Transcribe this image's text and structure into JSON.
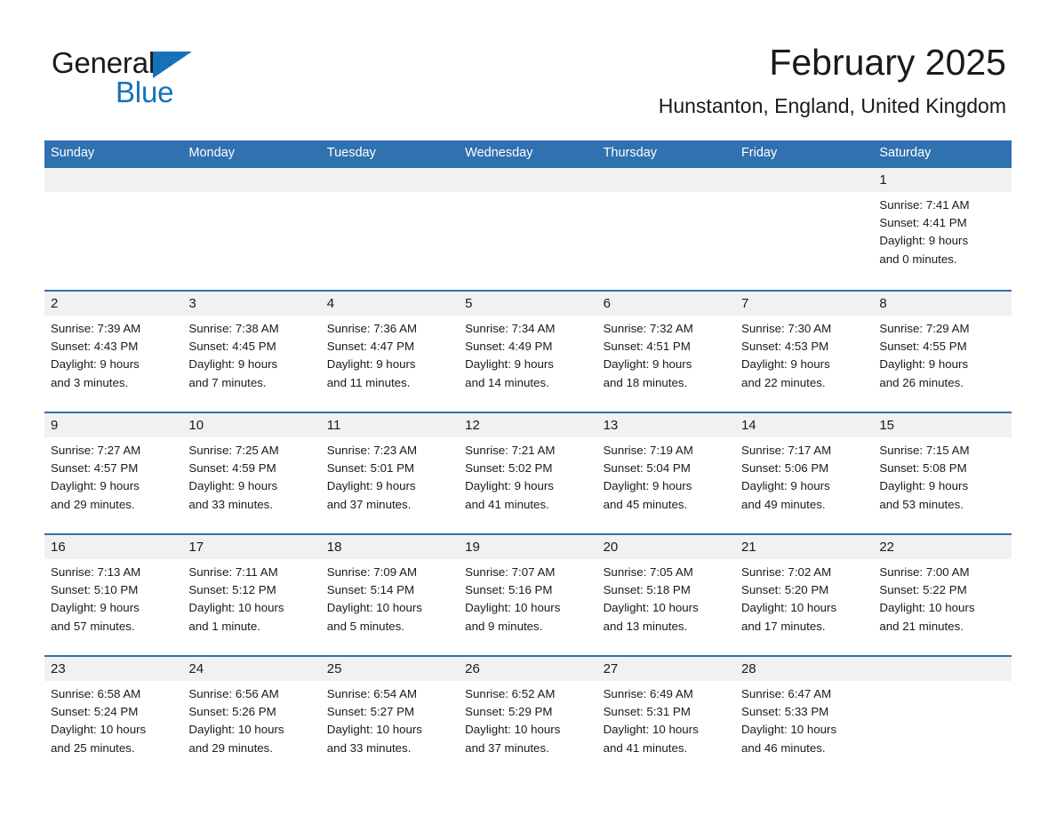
{
  "brand": {
    "name_part1": "General",
    "name_part2": "Blue",
    "triangle_color": "#1572b8",
    "text_color": "#1a1a1a"
  },
  "header": {
    "title": "February 2025",
    "subtitle": "Hunstanton, England, United Kingdom"
  },
  "theme": {
    "header_blue": "#3071b0",
    "daynum_band": "#f1f1f1",
    "text": "#1a1a1a"
  },
  "weekdays": [
    "Sunday",
    "Monday",
    "Tuesday",
    "Wednesday",
    "Thursday",
    "Friday",
    "Saturday"
  ],
  "weeks": [
    {
      "days": [
        {
          "num": "",
          "sunrise": "",
          "sunset": "",
          "daylight_line1": "",
          "daylight_line2": ""
        },
        {
          "num": "",
          "sunrise": "",
          "sunset": "",
          "daylight_line1": "",
          "daylight_line2": ""
        },
        {
          "num": "",
          "sunrise": "",
          "sunset": "",
          "daylight_line1": "",
          "daylight_line2": ""
        },
        {
          "num": "",
          "sunrise": "",
          "sunset": "",
          "daylight_line1": "",
          "daylight_line2": ""
        },
        {
          "num": "",
          "sunrise": "",
          "sunset": "",
          "daylight_line1": "",
          "daylight_line2": ""
        },
        {
          "num": "",
          "sunrise": "",
          "sunset": "",
          "daylight_line1": "",
          "daylight_line2": ""
        },
        {
          "num": "1",
          "sunrise": "Sunrise: 7:41 AM",
          "sunset": "Sunset: 4:41 PM",
          "daylight_line1": "Daylight: 9 hours",
          "daylight_line2": "and 0 minutes."
        }
      ]
    },
    {
      "days": [
        {
          "num": "2",
          "sunrise": "Sunrise: 7:39 AM",
          "sunset": "Sunset: 4:43 PM",
          "daylight_line1": "Daylight: 9 hours",
          "daylight_line2": "and 3 minutes."
        },
        {
          "num": "3",
          "sunrise": "Sunrise: 7:38 AM",
          "sunset": "Sunset: 4:45 PM",
          "daylight_line1": "Daylight: 9 hours",
          "daylight_line2": "and 7 minutes."
        },
        {
          "num": "4",
          "sunrise": "Sunrise: 7:36 AM",
          "sunset": "Sunset: 4:47 PM",
          "daylight_line1": "Daylight: 9 hours",
          "daylight_line2": "and 11 minutes."
        },
        {
          "num": "5",
          "sunrise": "Sunrise: 7:34 AM",
          "sunset": "Sunset: 4:49 PM",
          "daylight_line1": "Daylight: 9 hours",
          "daylight_line2": "and 14 minutes."
        },
        {
          "num": "6",
          "sunrise": "Sunrise: 7:32 AM",
          "sunset": "Sunset: 4:51 PM",
          "daylight_line1": "Daylight: 9 hours",
          "daylight_line2": "and 18 minutes."
        },
        {
          "num": "7",
          "sunrise": "Sunrise: 7:30 AM",
          "sunset": "Sunset: 4:53 PM",
          "daylight_line1": "Daylight: 9 hours",
          "daylight_line2": "and 22 minutes."
        },
        {
          "num": "8",
          "sunrise": "Sunrise: 7:29 AM",
          "sunset": "Sunset: 4:55 PM",
          "daylight_line1": "Daylight: 9 hours",
          "daylight_line2": "and 26 minutes."
        }
      ]
    },
    {
      "days": [
        {
          "num": "9",
          "sunrise": "Sunrise: 7:27 AM",
          "sunset": "Sunset: 4:57 PM",
          "daylight_line1": "Daylight: 9 hours",
          "daylight_line2": "and 29 minutes."
        },
        {
          "num": "10",
          "sunrise": "Sunrise: 7:25 AM",
          "sunset": "Sunset: 4:59 PM",
          "daylight_line1": "Daylight: 9 hours",
          "daylight_line2": "and 33 minutes."
        },
        {
          "num": "11",
          "sunrise": "Sunrise: 7:23 AM",
          "sunset": "Sunset: 5:01 PM",
          "daylight_line1": "Daylight: 9 hours",
          "daylight_line2": "and 37 minutes."
        },
        {
          "num": "12",
          "sunrise": "Sunrise: 7:21 AM",
          "sunset": "Sunset: 5:02 PM",
          "daylight_line1": "Daylight: 9 hours",
          "daylight_line2": "and 41 minutes."
        },
        {
          "num": "13",
          "sunrise": "Sunrise: 7:19 AM",
          "sunset": "Sunset: 5:04 PM",
          "daylight_line1": "Daylight: 9 hours",
          "daylight_line2": "and 45 minutes."
        },
        {
          "num": "14",
          "sunrise": "Sunrise: 7:17 AM",
          "sunset": "Sunset: 5:06 PM",
          "daylight_line1": "Daylight: 9 hours",
          "daylight_line2": "and 49 minutes."
        },
        {
          "num": "15",
          "sunrise": "Sunrise: 7:15 AM",
          "sunset": "Sunset: 5:08 PM",
          "daylight_line1": "Daylight: 9 hours",
          "daylight_line2": "and 53 minutes."
        }
      ]
    },
    {
      "days": [
        {
          "num": "16",
          "sunrise": "Sunrise: 7:13 AM",
          "sunset": "Sunset: 5:10 PM",
          "daylight_line1": "Daylight: 9 hours",
          "daylight_line2": "and 57 minutes."
        },
        {
          "num": "17",
          "sunrise": "Sunrise: 7:11 AM",
          "sunset": "Sunset: 5:12 PM",
          "daylight_line1": "Daylight: 10 hours",
          "daylight_line2": "and 1 minute."
        },
        {
          "num": "18",
          "sunrise": "Sunrise: 7:09 AM",
          "sunset": "Sunset: 5:14 PM",
          "daylight_line1": "Daylight: 10 hours",
          "daylight_line2": "and 5 minutes."
        },
        {
          "num": "19",
          "sunrise": "Sunrise: 7:07 AM",
          "sunset": "Sunset: 5:16 PM",
          "daylight_line1": "Daylight: 10 hours",
          "daylight_line2": "and 9 minutes."
        },
        {
          "num": "20",
          "sunrise": "Sunrise: 7:05 AM",
          "sunset": "Sunset: 5:18 PM",
          "daylight_line1": "Daylight: 10 hours",
          "daylight_line2": "and 13 minutes."
        },
        {
          "num": "21",
          "sunrise": "Sunrise: 7:02 AM",
          "sunset": "Sunset: 5:20 PM",
          "daylight_line1": "Daylight: 10 hours",
          "daylight_line2": "and 17 minutes."
        },
        {
          "num": "22",
          "sunrise": "Sunrise: 7:00 AM",
          "sunset": "Sunset: 5:22 PM",
          "daylight_line1": "Daylight: 10 hours",
          "daylight_line2": "and 21 minutes."
        }
      ]
    },
    {
      "days": [
        {
          "num": "23",
          "sunrise": "Sunrise: 6:58 AM",
          "sunset": "Sunset: 5:24 PM",
          "daylight_line1": "Daylight: 10 hours",
          "daylight_line2": "and 25 minutes."
        },
        {
          "num": "24",
          "sunrise": "Sunrise: 6:56 AM",
          "sunset": "Sunset: 5:26 PM",
          "daylight_line1": "Daylight: 10 hours",
          "daylight_line2": "and 29 minutes."
        },
        {
          "num": "25",
          "sunrise": "Sunrise: 6:54 AM",
          "sunset": "Sunset: 5:27 PM",
          "daylight_line1": "Daylight: 10 hours",
          "daylight_line2": "and 33 minutes."
        },
        {
          "num": "26",
          "sunrise": "Sunrise: 6:52 AM",
          "sunset": "Sunset: 5:29 PM",
          "daylight_line1": "Daylight: 10 hours",
          "daylight_line2": "and 37 minutes."
        },
        {
          "num": "27",
          "sunrise": "Sunrise: 6:49 AM",
          "sunset": "Sunset: 5:31 PM",
          "daylight_line1": "Daylight: 10 hours",
          "daylight_line2": "and 41 minutes."
        },
        {
          "num": "28",
          "sunrise": "Sunrise: 6:47 AM",
          "sunset": "Sunset: 5:33 PM",
          "daylight_line1": "Daylight: 10 hours",
          "daylight_line2": "and 46 minutes."
        },
        {
          "num": "",
          "sunrise": "",
          "sunset": "",
          "daylight_line1": "",
          "daylight_line2": ""
        }
      ]
    }
  ]
}
